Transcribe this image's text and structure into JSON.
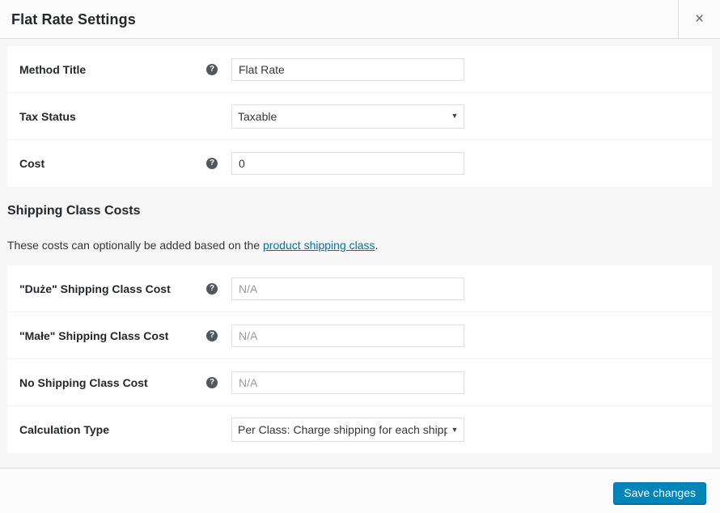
{
  "header": {
    "title": "Flat Rate Settings",
    "close_label": "×"
  },
  "main_settings": {
    "rows": [
      {
        "label": "Method Title",
        "help": "?",
        "control": "text",
        "value": "Flat Rate",
        "placeholder": ""
      },
      {
        "label": "Tax Status",
        "help": "",
        "control": "select",
        "value": "Taxable",
        "arrow": "▼"
      },
      {
        "label": "Cost",
        "help": "?",
        "control": "text",
        "value": "0",
        "placeholder": ""
      }
    ]
  },
  "shipping_class_section": {
    "heading": "Shipping Class Costs",
    "description_before": "These costs can optionally be added based on the ",
    "link_text": "product shipping class",
    "description_after": ".",
    "rows": [
      {
        "label": "\"Duże\" Shipping Class Cost",
        "help": "?",
        "control": "text",
        "value": "",
        "placeholder": "N/A"
      },
      {
        "label": "\"Małe\" Shipping Class Cost",
        "help": "?",
        "control": "text",
        "value": "",
        "placeholder": "N/A"
      },
      {
        "label": "No Shipping Class Cost",
        "help": "?",
        "control": "text",
        "value": "",
        "placeholder": "N/A"
      },
      {
        "label": "Calculation Type",
        "help": "",
        "control": "select",
        "value": "Per Class: Charge shipping for each shipping class individually",
        "arrow": "▼"
      }
    ]
  },
  "footer": {
    "save_label": "Save changes"
  },
  "colors": {
    "accent": "#0085ba",
    "link": "#0073aa",
    "title": "#23282d",
    "panel": "#ffffff",
    "backdrop": "#f6f6f6"
  }
}
